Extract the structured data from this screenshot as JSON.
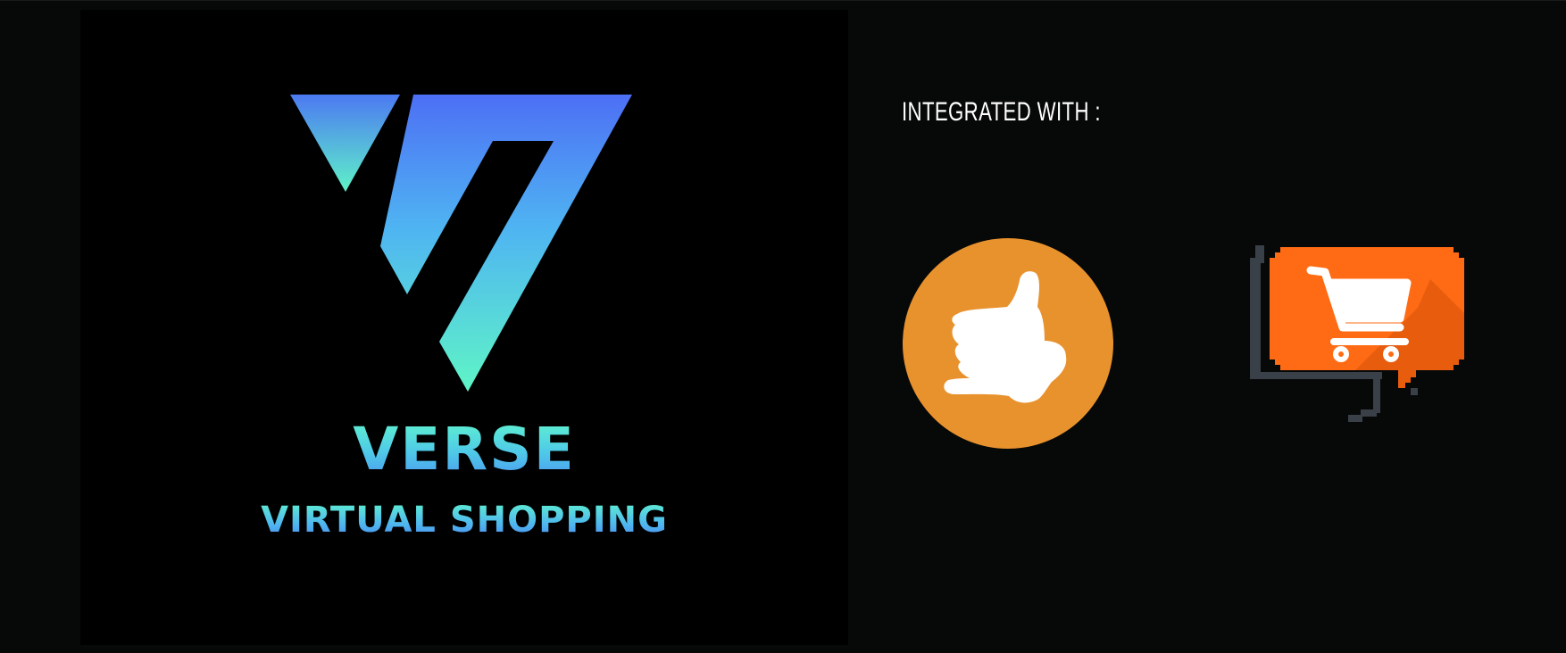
{
  "brand": {
    "name": "VERSE",
    "tagline": "VIRTUAL SHOPPING",
    "logo_icon": "v-triangle-logo-icon",
    "gradient_colors": [
      "#4d6ff0",
      "#4fb3f2",
      "#5ff5c8"
    ]
  },
  "integrations": {
    "label": "INTEGRATED WITH :",
    "items": [
      {
        "icon": "thumbs-up-icon",
        "color": "#e8922e"
      },
      {
        "icon": "shopping-cart-icon",
        "color": "#ff6b14"
      }
    ]
  },
  "colors": {
    "background": "#070808",
    "panel": "#000000",
    "text": "#ffffff"
  }
}
